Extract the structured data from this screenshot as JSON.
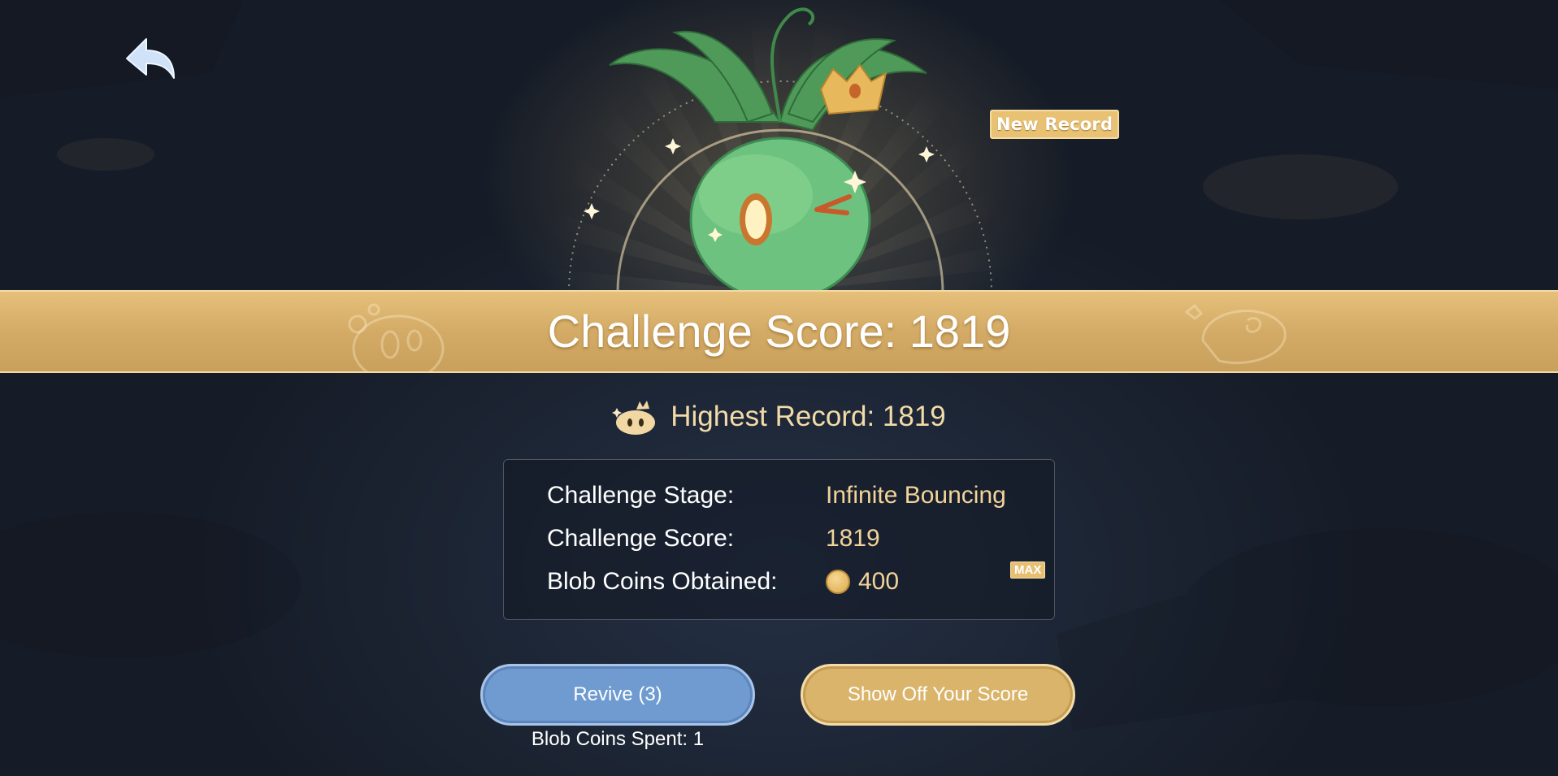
{
  "header": {
    "back_icon": "back-arrow-icon",
    "new_record_badge": "New Record"
  },
  "banner": {
    "title": "Challenge Score: 1819"
  },
  "highest_record": {
    "icon": "crowned-blob-icon",
    "text": "Highest Record: 1819"
  },
  "results": {
    "rows": [
      {
        "label": "Challenge Stage:",
        "value": "Infinite Bouncing"
      },
      {
        "label": "Challenge Score:",
        "value": "1819"
      },
      {
        "label": "Blob Coins Obtained:",
        "value": "400",
        "icon": "blob-coin-icon"
      }
    ],
    "max_badge": "MAX"
  },
  "actions": {
    "revive_label": "Revive (3)",
    "show_off_label": "Show Off Your Score",
    "coins_spent": "Blob Coins Spent: 1"
  },
  "colors": {
    "gold": "#d9b26a",
    "revive_blue": "#6f9bd0",
    "text_gold": "#f2d39a"
  }
}
